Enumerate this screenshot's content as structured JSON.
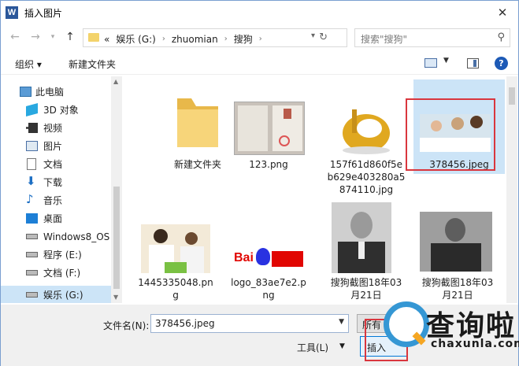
{
  "window": {
    "title": "插入图片",
    "close_glyph": "✕"
  },
  "nav": {
    "crumbs": [
      "«",
      "娱乐 (G:)",
      "zhuomian",
      "搜狗"
    ],
    "search_placeholder": "搜索\"搜狗\""
  },
  "toolbar": {
    "organize": "组织 ▾",
    "new_folder": "新建文件夹"
  },
  "sidebar": {
    "items": [
      {
        "label": "此电脑",
        "icon": "computer-icon"
      },
      {
        "label": "3D 对象",
        "icon": "3d-objects-icon"
      },
      {
        "label": "视频",
        "icon": "video-icon"
      },
      {
        "label": "图片",
        "icon": "pictures-icon"
      },
      {
        "label": "文档",
        "icon": "documents-icon"
      },
      {
        "label": "下载",
        "icon": "download-icon"
      },
      {
        "label": "音乐",
        "icon": "music-icon"
      },
      {
        "label": "桌面",
        "icon": "desktop-icon"
      },
      {
        "label": "Windows8_OS",
        "icon": "drive-icon"
      },
      {
        "label": "程序 (E:)",
        "icon": "drive-icon"
      },
      {
        "label": "文档 (F:)",
        "icon": "drive-icon"
      },
      {
        "label": "娱乐 (G:)",
        "icon": "drive-icon",
        "selected": true
      }
    ]
  },
  "files": [
    {
      "name_lines": [
        "新建文件夹"
      ],
      "type": "folder"
    },
    {
      "name_lines": [
        "123.png"
      ],
      "type": "image"
    },
    {
      "name_lines": [
        "157f61d860f5e",
        "b629e403280a5",
        "874110.jpg"
      ],
      "type": "image"
    },
    {
      "name_lines": [
        "378456.jpeg"
      ],
      "type": "image",
      "selected": true
    },
    {
      "name_lines": [
        "1445335048.pn",
        "g"
      ],
      "type": "image"
    },
    {
      "name_lines": [
        "logo_83ae7e2.p",
        "ng"
      ],
      "type": "image"
    },
    {
      "name_lines": [
        "搜狗截图18年03",
        "月21日"
      ],
      "type": "image"
    },
    {
      "name_lines": [
        "搜狗截图18年03",
        "月21日"
      ],
      "type": "image"
    }
  ],
  "bottom": {
    "filename_label": "文件名(N):",
    "filename_value": "378456.jpeg",
    "type_button": "所有",
    "tools": "工具(L)",
    "insert_button": "插入"
  },
  "watermark": {
    "text": "查询啦",
    "sub": "chaxunla.com"
  },
  "colors": {
    "accent": "#0078d7",
    "highlight": "#d9363e",
    "selection": "#cce4f7"
  }
}
